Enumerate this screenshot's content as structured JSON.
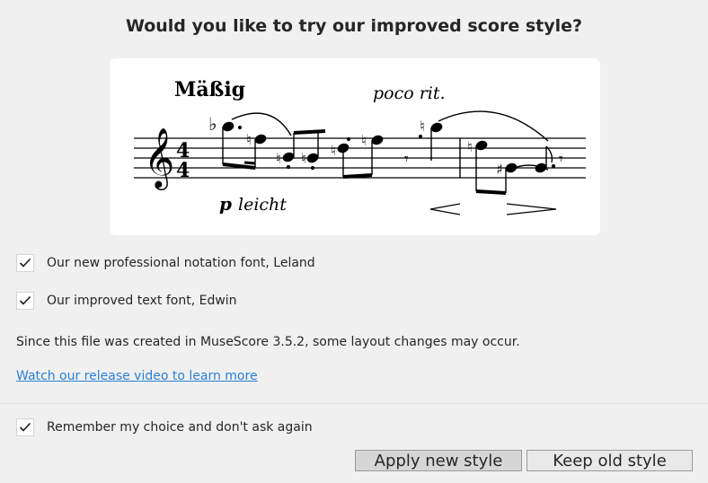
{
  "dialog": {
    "title": "Would you like to try our improved score style?",
    "preview": {
      "tempo": "Mäßig",
      "expression": "poco rit.",
      "dynamic": "p",
      "dynamic_text": "leicht",
      "time_signature": "4/4"
    },
    "options": [
      {
        "label": "Our new professional notation font, Leland",
        "checked": true
      },
      {
        "label": "Our improved text font, Edwin",
        "checked": true
      }
    ],
    "info_text": "Since this file was created in MuseScore 3.5.2, some layout changes may occur.",
    "link_text": "Watch our release video to learn more",
    "remember": {
      "label": "Remember my choice and don't ask again",
      "checked": true
    },
    "buttons": {
      "apply": "Apply new style",
      "keep": "Keep old style"
    },
    "colors": {
      "background": "#f0f0f0",
      "link": "#2a7fd4",
      "preview_bg": "#ffffff"
    }
  }
}
